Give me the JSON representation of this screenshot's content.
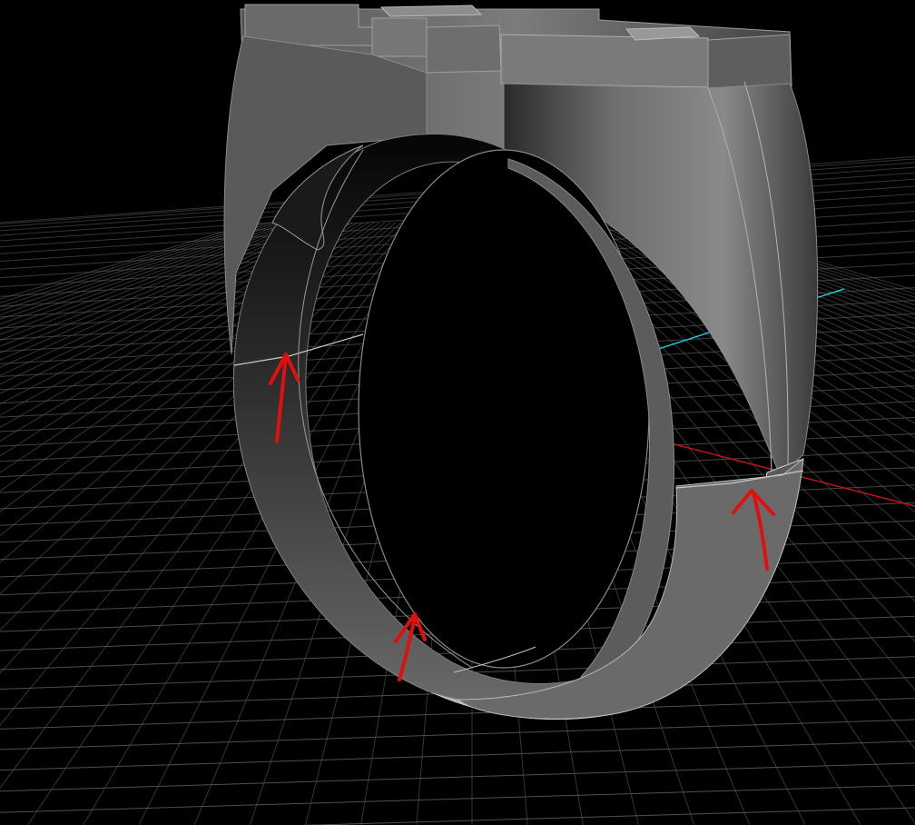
{
  "viewport": {
    "background_color": "#000000",
    "grid_color": "#5a5a5a",
    "x_axis_color": "#c41616",
    "z_axis_color": "#2bbfd0",
    "model_color": "#6e6e6e",
    "annotation_color": "#e01010"
  },
  "model": {
    "object": "signet-ring"
  },
  "annotations": {
    "count": 3,
    "shape": "arrow",
    "marks_seam_lines": true
  }
}
